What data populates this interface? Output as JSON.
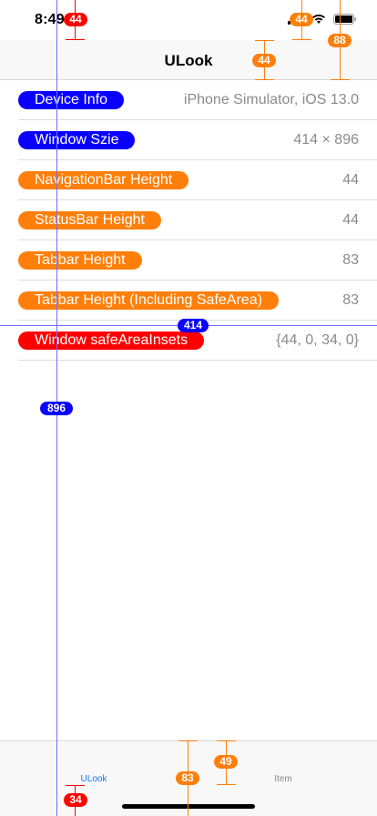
{
  "status_bar": {
    "time": "8:49",
    "icons": [
      "signal-icon",
      "wifi-icon",
      "battery-icon"
    ]
  },
  "nav": {
    "title": "ULook"
  },
  "rows": [
    {
      "label": "Device Info",
      "value": "iPhone Simulator, iOS 13.0",
      "color": "#0a00ff"
    },
    {
      "label": "Window Szie",
      "value": "414 × 896",
      "color": "#0a00ff"
    },
    {
      "label": "NavigationBar Height",
      "value": "44",
      "color": "#ff7f0a"
    },
    {
      "label": "StatusBar Height",
      "value": "44",
      "color": "#ff7f0a"
    },
    {
      "label": "Tabbar Height",
      "value": "83",
      "color": "#ff7f0a"
    },
    {
      "label": "Tabbar Height (Including SafeArea)",
      "value": "83",
      "color": "#ff7f0a"
    },
    {
      "label": "Window safeAreaInsets",
      "value": "{44, 0, 34, 0}",
      "color": "#ff0000"
    }
  ],
  "tabs": [
    {
      "label": "ULook",
      "selected": true
    },
    {
      "label": "Item",
      "selected": false
    }
  ],
  "badges": {
    "status_top_left": "44",
    "status_top_right": "44",
    "nav_right": "88",
    "nav_center": "44",
    "width": "414",
    "height": "896",
    "tab_83": "83",
    "tab_49": "49",
    "safe_bottom": "34"
  }
}
